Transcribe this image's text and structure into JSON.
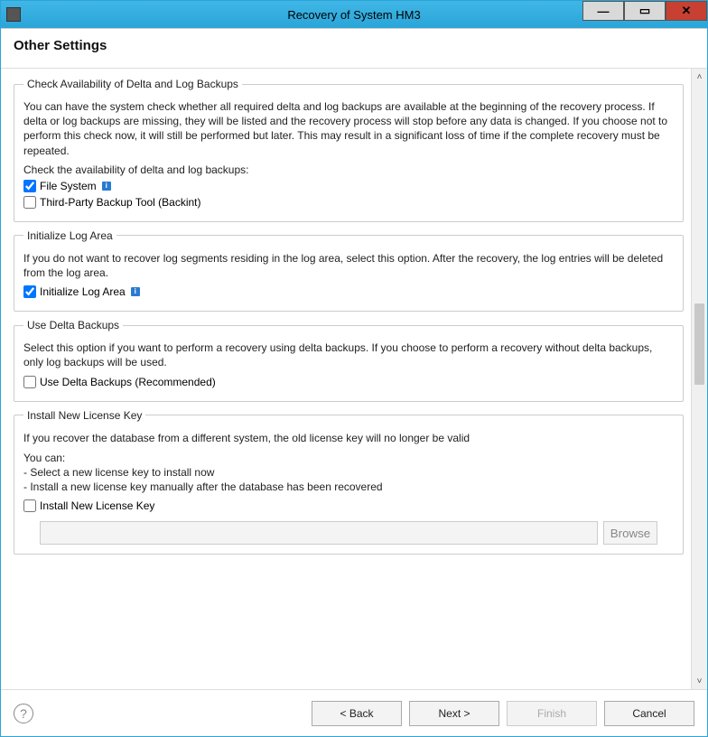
{
  "window": {
    "title": "Recovery of System HM3"
  },
  "page": {
    "heading": "Other Settings"
  },
  "groups": {
    "delta_check": {
      "legend": "Check Availability of Delta and Log Backups",
      "desc": "You can have the system check whether all required delta and log backups are available at the beginning of the recovery process. If delta or log backups are missing, they will be listed and the recovery process will stop before any data is changed. If you choose not to perform this check now, it will still be performed but later. This may result in a significant loss of time if the complete recovery must be repeated.",
      "subdesc": "Check the availability of delta and log backups:",
      "file_system": {
        "label": "File System",
        "checked": true
      },
      "backint": {
        "label": "Third-Party Backup Tool (Backint)",
        "checked": false
      }
    },
    "init_log": {
      "legend": "Initialize Log Area",
      "desc": "If you do not want to recover log segments residing in the log area, select this option. After the recovery, the log entries will be deleted from the log area.",
      "checkbox": {
        "label": "Initialize Log Area",
        "checked": true
      }
    },
    "use_delta": {
      "legend": "Use Delta Backups",
      "desc": "Select this option if you want to perform a recovery using delta backups. If you choose to perform a recovery without delta backups, only log backups will be used.",
      "checkbox": {
        "label": "Use Delta Backups (Recommended)",
        "checked": false
      }
    },
    "license": {
      "legend": "Install New License Key",
      "line1": "If you recover the database from a different system, the old license key will no longer be valid",
      "line2": "You can:",
      "line3": "- Select a new license key to install now",
      "line4": "- Install a new license key manually after the database has been recovered",
      "checkbox": {
        "label": "Install New License Key",
        "checked": false
      },
      "path": "",
      "browse": "Browse"
    }
  },
  "footer": {
    "back": "< Back",
    "next": "Next >",
    "finish": "Finish",
    "cancel": "Cancel"
  }
}
